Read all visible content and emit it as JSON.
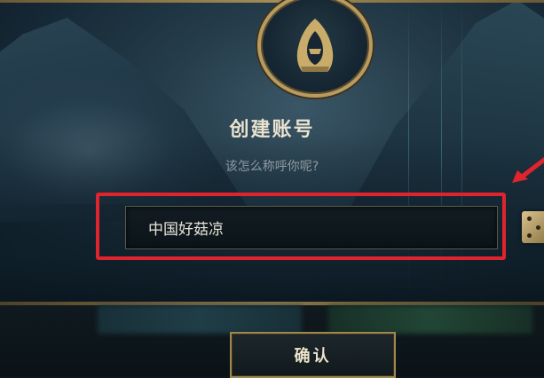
{
  "dialog": {
    "title": "创建账号",
    "subtitle": "该怎么称呼你呢?",
    "emblem_icon": "hooded-assassin-icon"
  },
  "name_field": {
    "value": "中国好菇凉"
  },
  "actions": {
    "confirm_label": "确认",
    "random_name_icon": "dice-icon"
  },
  "annotations": {
    "highlight_color": "#e0242e",
    "arrow_color": "#e0242e"
  },
  "colors": {
    "gold_accent": "#b89b5e",
    "title_text": "#e9e2cf"
  }
}
